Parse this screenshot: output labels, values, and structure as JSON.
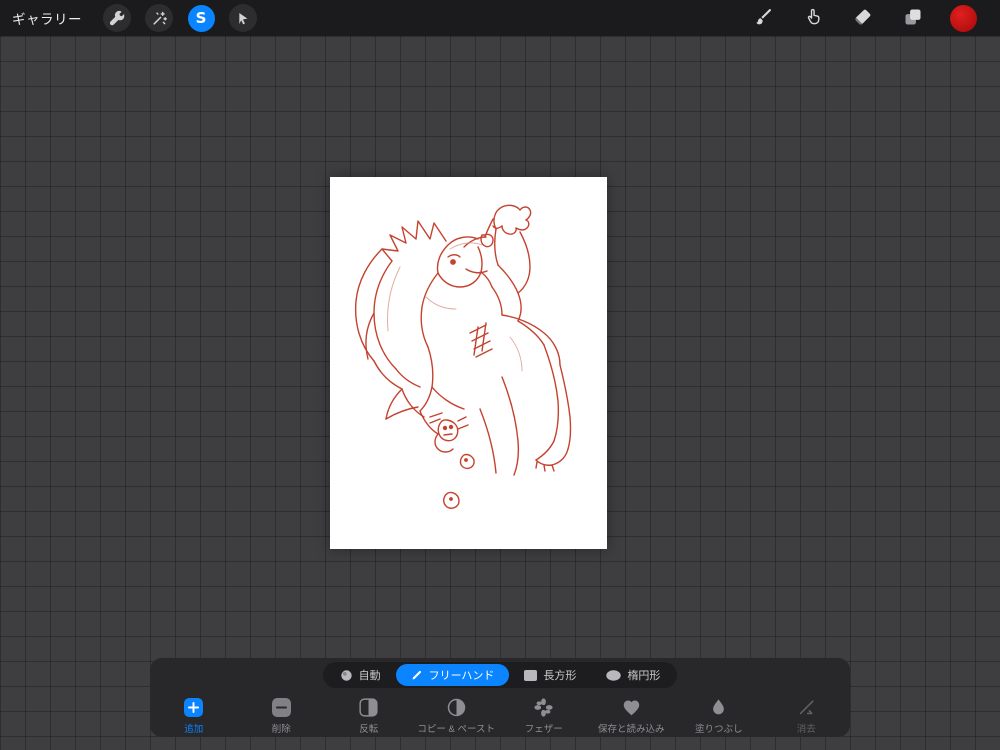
{
  "top_bar": {
    "gallery_label": "ギャラリー",
    "selection_glyph": "S",
    "accent_blue": "#0a84ff",
    "color_swatch": "#c21515",
    "tools_left": [
      "actions-wrench",
      "adjustments-wand",
      "selection-active",
      "transform-arrow"
    ],
    "tools_right": [
      "brush",
      "smudge",
      "eraser",
      "layers",
      "color-swatch"
    ]
  },
  "canvas": {
    "background": "#3e3e40",
    "selection_grid_overlay": true,
    "artboard_color": "#ffffff",
    "sketch_color": "#c5422f"
  },
  "selection_panel": {
    "modes": [
      {
        "label": "自動",
        "icon": "automatic-icon",
        "active": false
      },
      {
        "label": "フリーハンド",
        "icon": "freehand-pencil-icon",
        "active": true
      },
      {
        "label": "長方形",
        "icon": "rectangle-icon",
        "active": false
      },
      {
        "label": "楕円形",
        "icon": "ellipse-icon",
        "active": false
      }
    ],
    "actions": [
      {
        "label": "追加",
        "icon": "plus-square-icon",
        "active": true
      },
      {
        "label": "削除",
        "icon": "minus-square-icon",
        "active": false
      },
      {
        "label": "反転",
        "icon": "invert-icon",
        "active": false
      },
      {
        "label": "コピー & ペースト",
        "icon": "copy-paste-icon",
        "active": false
      },
      {
        "label": "フェザー",
        "icon": "feather-icon",
        "active": false
      },
      {
        "label": "保存と読み込み",
        "icon": "save-load-heart-icon",
        "active": false
      },
      {
        "label": "塗りつぶし",
        "icon": "color-fill-drop-icon",
        "active": false
      },
      {
        "label": "消去",
        "icon": "clear-brush-icon",
        "active": false,
        "enabled": false
      }
    ]
  }
}
